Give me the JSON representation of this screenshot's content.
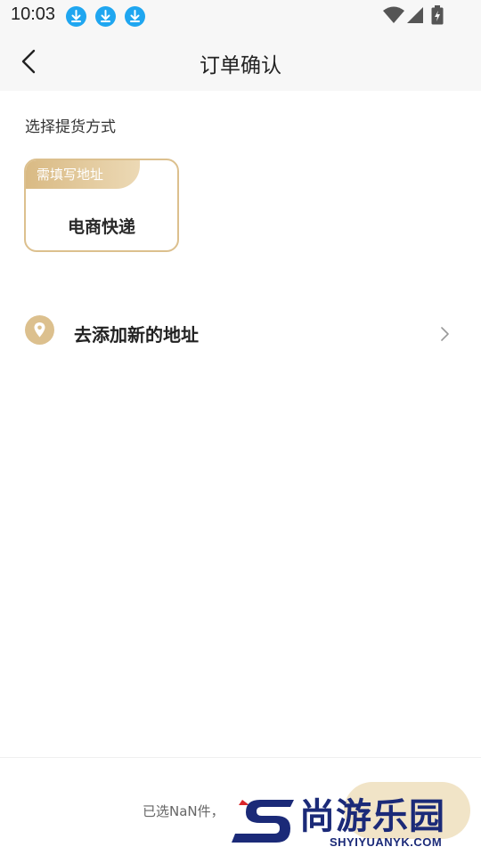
{
  "status_bar": {
    "time": "10:03",
    "icons": [
      "download-icon",
      "download-icon",
      "download-icon",
      "wifi-icon",
      "signal-icon",
      "battery-icon"
    ]
  },
  "nav": {
    "back_icon": "chevron-left-icon",
    "title": "订单确认"
  },
  "delivery": {
    "section_label": "选择提货方式",
    "options": [
      {
        "tag": "需填写地址",
        "label": "电商快递",
        "selected": true
      }
    ]
  },
  "address": {
    "icon": "location-pin-icon",
    "label": "去添加新的地址",
    "chevron": "chevron-right-icon"
  },
  "footer": {
    "selected_text": "已选NaN件，"
  },
  "watermark": {
    "text": "尚游乐园",
    "sub": "SHYIYUANYK.COM"
  },
  "colors": {
    "accent_gold": "#dcc08e",
    "download_blue": "#1fa6f0",
    "submit_bg": "#f1e4c7",
    "watermark_navy": "#1b2a78",
    "watermark_red": "#d9262b"
  }
}
